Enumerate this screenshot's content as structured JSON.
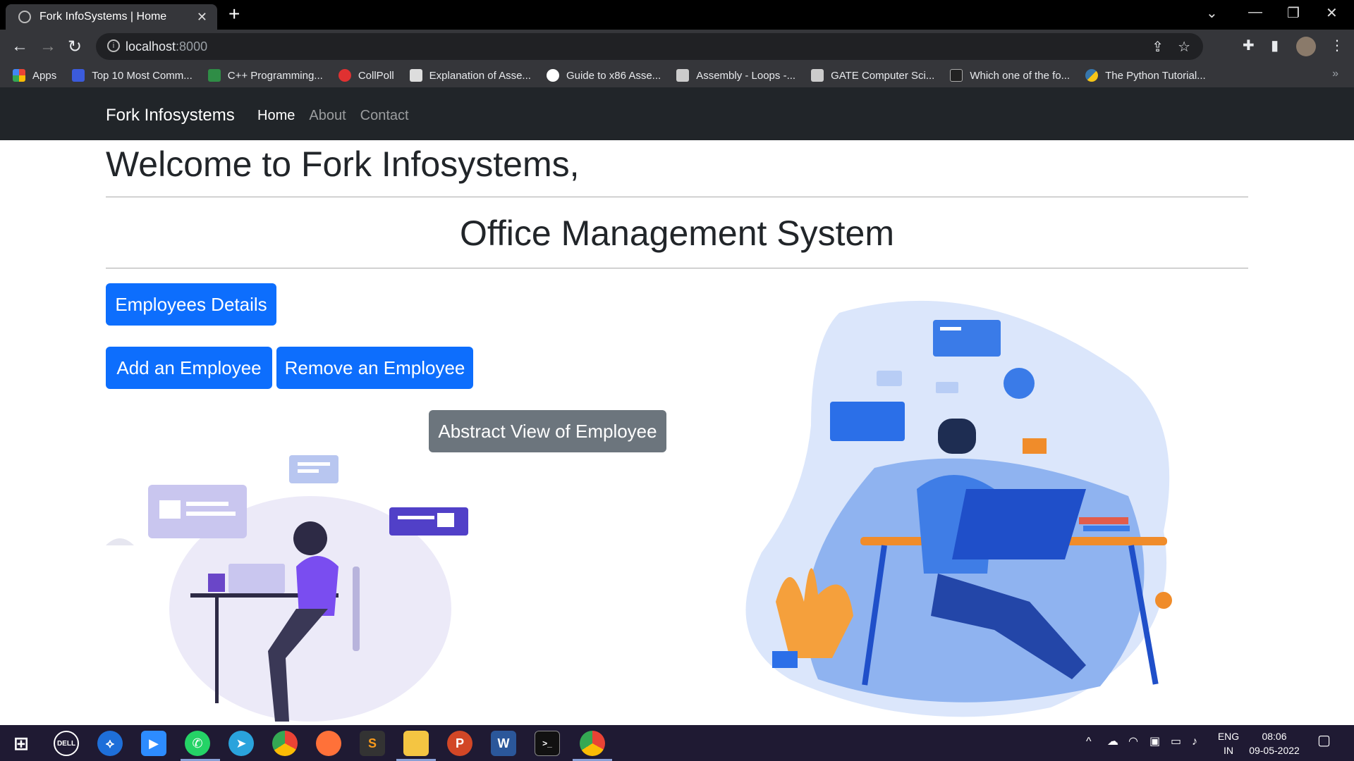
{
  "browser": {
    "tab_title": "Fork InfoSystems | Home",
    "url_host": "localhost",
    "url_port": ":8000",
    "bookmarks": [
      {
        "label": "Apps",
        "color": "#ea4335"
      },
      {
        "label": "Top 10 Most Comm...",
        "color": "#3b5bdb"
      },
      {
        "label": "C++ Programming...",
        "color": "#2f8d46"
      },
      {
        "label": "CollPoll",
        "color": "#e03131"
      },
      {
        "label": "Explanation of Asse...",
        "color": "#dddddd"
      },
      {
        "label": "Guide to x86 Asse...",
        "color": "#ffffff"
      },
      {
        "label": "Assembly - Loops -...",
        "color": "#cccccc"
      },
      {
        "label": "GATE Computer Sci...",
        "color": "#cccccc"
      },
      {
        "label": "Which one of the fo...",
        "color": "#222222"
      },
      {
        "label": "The Python Tutorial...",
        "color": "#f5c518"
      }
    ]
  },
  "navbar": {
    "brand": "Fork Infosystems",
    "links": [
      "Home",
      "About",
      "Contact"
    ]
  },
  "main": {
    "welcome": "Welcome to Fork Infosystems,",
    "subtitle": "Office Management System",
    "buttons": {
      "employees_details": "Employees Details",
      "add_employee": "Add an Employee",
      "remove_employee": "Remove an Employee",
      "abstract_view": "Abstract View of Employee"
    }
  },
  "taskbar": {
    "apps": [
      "windows-start",
      "dell",
      "edge-like",
      "zoom",
      "whatsapp",
      "telegram",
      "chrome",
      "firefox",
      "sublime",
      "file-explorer",
      "powerpoint",
      "word",
      "terminal",
      "chrome-active"
    ],
    "lang_top": "ENG",
    "lang_bottom": "IN",
    "time": "08:06",
    "date": "09-05-2022"
  },
  "colors": {
    "primary": "#0d6efd",
    "secondary": "#6c757d",
    "navbar": "#212529"
  }
}
